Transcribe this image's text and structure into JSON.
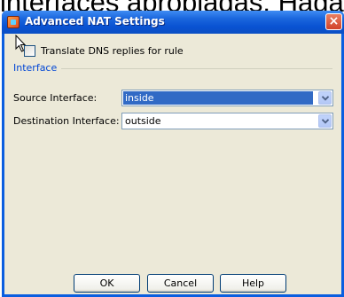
{
  "background": {
    "caption": "interfaces apropiadas. Haga"
  },
  "window": {
    "title": "Advanced NAT Settings",
    "close_label": "×"
  },
  "options": {
    "translate_dns_label": "Translate DNS replies for rule",
    "translate_dns_checked": false
  },
  "interface_group": {
    "legend": "Interface",
    "source_label": "Source Interface:",
    "source_value": "inside",
    "destination_label": "Destination Interface:",
    "destination_value": "outside"
  },
  "buttons": {
    "ok": "OK",
    "cancel": "Cancel",
    "help": "Help"
  },
  "colors": {
    "titlebar": "#0a5ee0",
    "dialog_bg": "#ece9d8",
    "selection": "#316ac5",
    "group_legend": "#0046d5"
  }
}
